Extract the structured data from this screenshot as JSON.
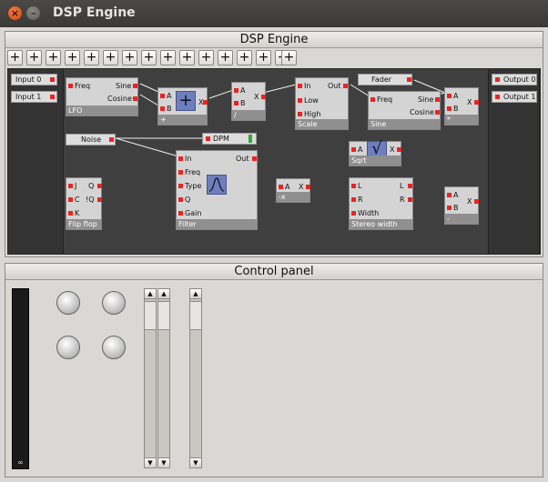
{
  "window": {
    "title": "DSP Engine",
    "close_icon": "close-icon",
    "minimize_icon": "minimize-icon"
  },
  "engine": {
    "title": "DSP Engine",
    "toolbar_button": "+",
    "toolbar_count": 16
  },
  "inputs": [
    "Input 0",
    "Input 1"
  ],
  "outputs": [
    "Output 0",
    "Output 1"
  ],
  "nodes": {
    "lfo": {
      "title": "LFO",
      "in": "Freq",
      "out1": "Sine",
      "out2": "Cosine"
    },
    "add": {
      "title": "+",
      "a": "A",
      "b": "B",
      "x": "X",
      "icon": "+"
    },
    "div": {
      "title": "/",
      "a": "A",
      "b": "B",
      "x": "X"
    },
    "scale": {
      "title": "Scale",
      "in": "In",
      "low": "Low",
      "high": "High",
      "out": "Out"
    },
    "sine": {
      "title": "Sine",
      "in": "Freq",
      "out1": "Sine",
      "out2": "Cosine"
    },
    "mul": {
      "title": "*",
      "a": "A",
      "b": "B",
      "x": "X"
    },
    "fader": {
      "label": "Fader"
    },
    "noise": {
      "label": "Noise"
    },
    "dpm": {
      "label": "DPM"
    },
    "sqrt": {
      "title": "Sqrt",
      "a": "A",
      "x": "X",
      "icon": "√"
    },
    "filter": {
      "title": "Filter",
      "in": "In",
      "freq": "Freq",
      "type": "Type",
      "q": "Q",
      "gain": "Gain",
      "out": "Out"
    },
    "neg": {
      "title": "-x",
      "a": "A",
      "x": "X"
    },
    "flipflop": {
      "title": "Flip flop",
      "j": "J",
      "c": "C",
      "k": "K",
      "q": "Q",
      "nq": "!Q"
    },
    "stereo": {
      "title": "Stereo width",
      "l": "L",
      "r": "R",
      "width": "Width",
      "lo": "L",
      "ro": "R"
    },
    "sub": {
      "title": "-",
      "a": "A",
      "b": "B",
      "x": "X"
    }
  },
  "control": {
    "title": "Control panel",
    "vu_label": "∞"
  },
  "colors": {
    "pin": "#e22",
    "canvas": "#3f3f3f",
    "icon_bg": "#6e7ebd"
  }
}
